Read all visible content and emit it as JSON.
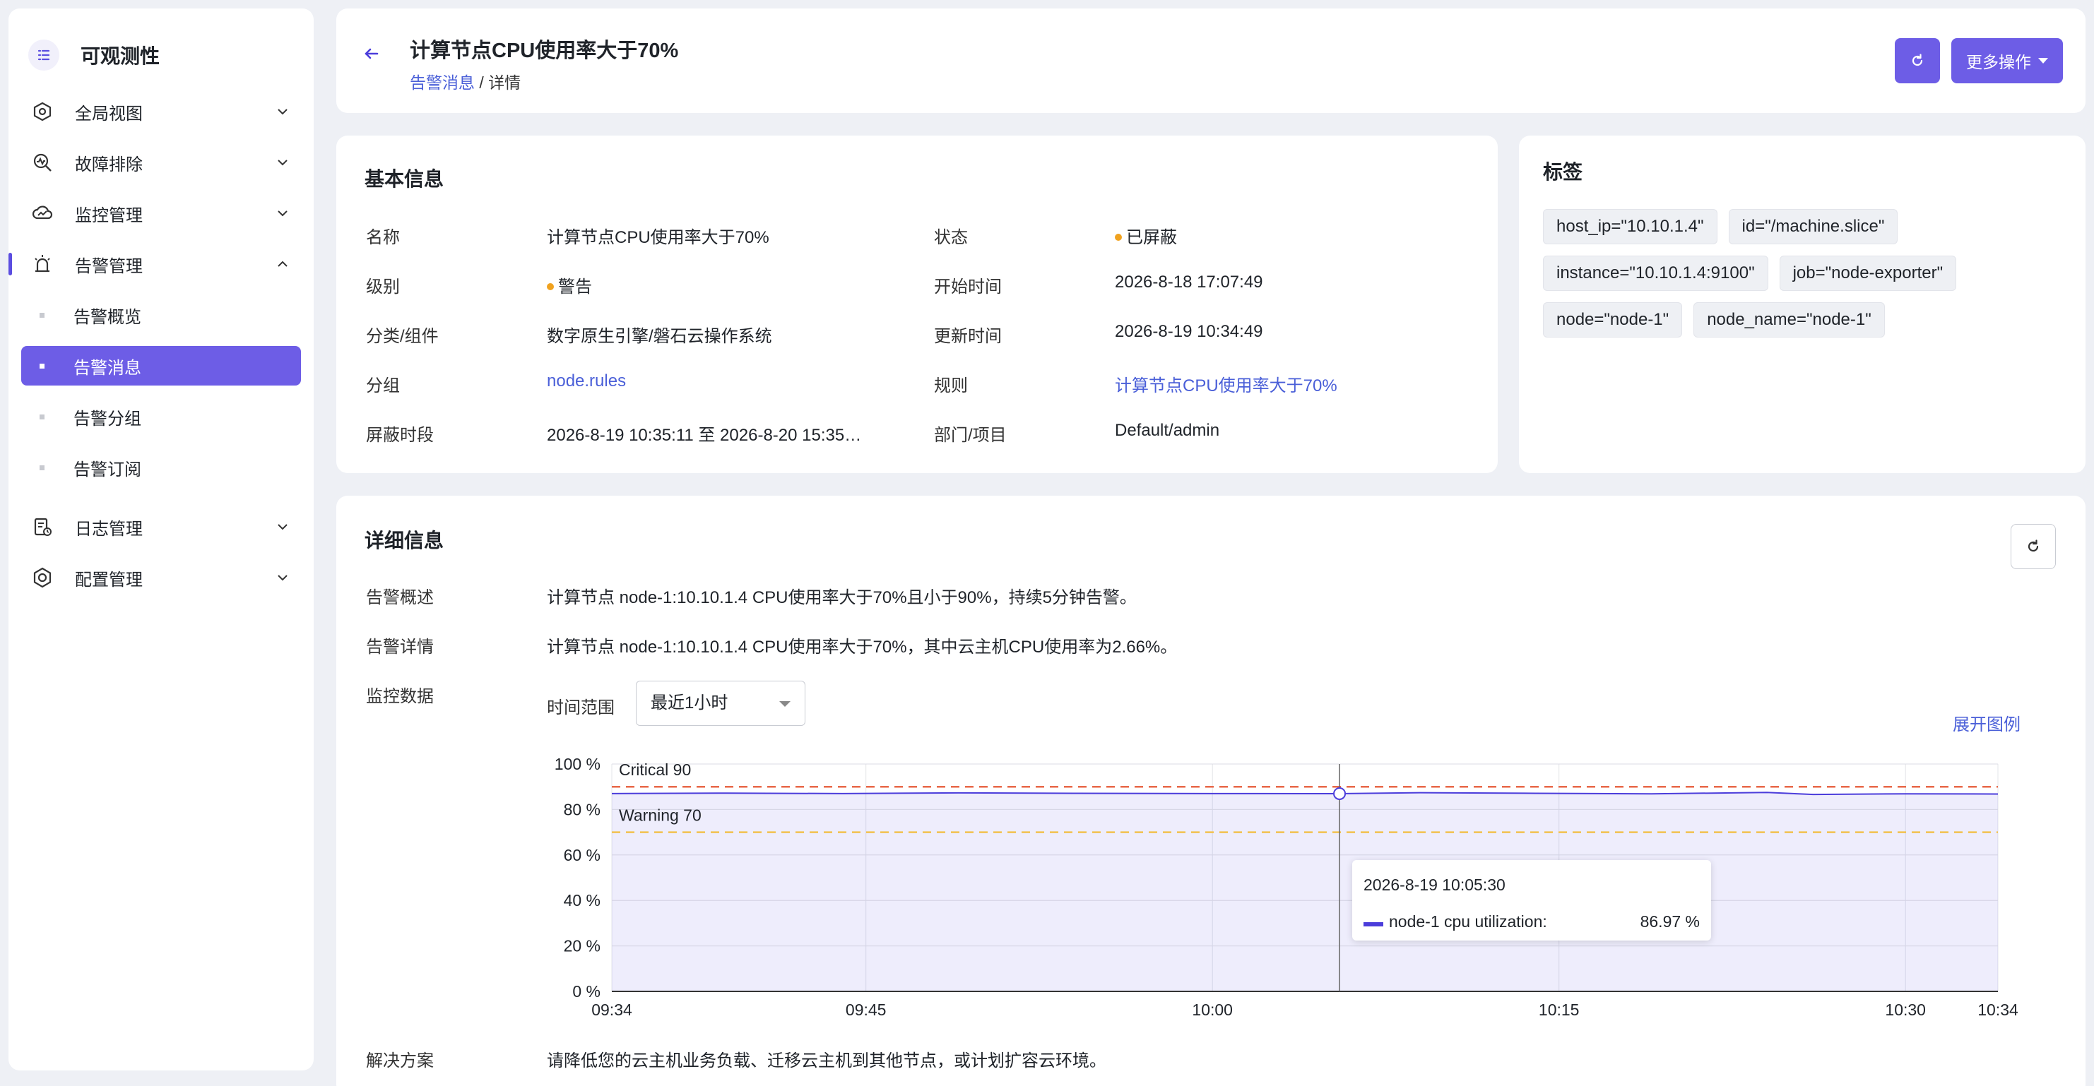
{
  "app": {
    "title": "可观测性"
  },
  "sidebar": {
    "groups": [
      {
        "label": "全局视图",
        "icon": "hexagon-icon"
      },
      {
        "label": "故障排除",
        "icon": "diagnosis-icon"
      },
      {
        "label": "监控管理",
        "icon": "cloud-monitor-icon"
      },
      {
        "label": "告警管理",
        "icon": "alarm-icon",
        "expanded": true
      },
      {
        "label": "日志管理",
        "icon": "log-icon"
      },
      {
        "label": "配置管理",
        "icon": "gear-icon"
      }
    ],
    "alert_sub": [
      "告警概览",
      "告警消息",
      "告警分组",
      "告警订阅"
    ],
    "active_sub": "告警消息"
  },
  "header": {
    "title": "计算节点CPU使用率大于70%",
    "breadcrumb_parent": "告警消息",
    "breadcrumb_sep": "/",
    "breadcrumb_current": "详情",
    "more_label": "更多操作"
  },
  "basic": {
    "title": "基本信息",
    "rows": [
      {
        "label": "名称",
        "value": "计算节点CPU使用率大于70%"
      },
      {
        "label": "级别",
        "value": "警告"
      },
      {
        "label": "分类/组件",
        "value": "数字原生引擎/磐石云操作系统"
      },
      {
        "label": "分组",
        "value": "node.rules"
      },
      {
        "label": "屏蔽时段",
        "value": "2026-8-19 10:35:11 至 2026-8-20 15:35…"
      }
    ],
    "rows_right": [
      {
        "label": "状态",
        "value": "已屏蔽"
      },
      {
        "label": "开始时间",
        "value": "2026-8-18 17:07:49"
      },
      {
        "label": "更新时间",
        "value": "2026-8-19 10:34:49"
      },
      {
        "label": "规则",
        "value": "计算节点CPU使用率大于70%"
      },
      {
        "label": "部门/项目",
        "value": "Default/admin"
      }
    ]
  },
  "tags": {
    "title": "标签",
    "items": [
      "host_ip=\"10.10.1.4\"",
      "id=\"/machine.slice\"",
      "instance=\"10.10.1.4:9100\"",
      "job=\"node-exporter\"",
      "node=\"node-1\"",
      "node_name=\"node-1\""
    ]
  },
  "detail": {
    "title": "详细信息",
    "summary_label": "告警概述",
    "summary": "计算节点 node-1:10.10.1.4 CPU使用率大于70%且小于90%，持续5分钟告警。",
    "detail_label": "告警详情",
    "detail": "计算节点 node-1:10.10.1.4 CPU使用率大于70%，其中云主机CPU使用率为2.66%。",
    "monitor_label": "监控数据",
    "time_range_label": "时间范围",
    "time_range_value": "最近1小时",
    "legend_toggle": "展开图例",
    "solution_label": "解决方案",
    "solution": "请降低您的云主机业务负载、迁移云主机到其他节点，或计划扩容云环境。"
  },
  "chart_data": {
    "type": "area",
    "x": [
      "09:34",
      "09:45",
      "10:00",
      "10:05:30",
      "10:15",
      "10:30",
      "10:34"
    ],
    "x_ticks": [
      "09:34",
      "09:45",
      "10:00",
      "10:15",
      "10:30",
      "10:34"
    ],
    "x_tick_minutes": [
      0,
      11,
      26,
      41,
      56,
      60
    ],
    "series": [
      {
        "name": "node-1 cpu utilization",
        "color": "#4b3ddb",
        "points": [
          [
            0,
            87.0
          ],
          [
            5,
            87.2
          ],
          [
            10,
            87.0
          ],
          [
            15,
            87.3
          ],
          [
            20,
            87.1
          ],
          [
            26,
            87.0
          ],
          [
            31.5,
            86.97
          ],
          [
            35,
            87.4
          ],
          [
            40,
            87.1
          ],
          [
            45,
            86.9
          ],
          [
            50,
            87.5
          ],
          [
            52,
            86.6
          ],
          [
            56,
            86.9
          ],
          [
            60,
            86.8
          ]
        ]
      }
    ],
    "thresholds": [
      {
        "label": "Critical 90",
        "value": 90,
        "color": "#e8694a"
      },
      {
        "label": "Warning 70",
        "value": 70,
        "color": "#f2c14e"
      }
    ],
    "y_ticks": [
      "100 %",
      "80 %",
      "60 %",
      "40 %",
      "20 %",
      "0 %"
    ],
    "ylim": [
      0,
      100
    ],
    "tooltip": {
      "time": "2026-8-19 10:05:30",
      "series": "node-1 cpu utilization:",
      "value": "86.97 %",
      "minute": 31.5
    }
  }
}
